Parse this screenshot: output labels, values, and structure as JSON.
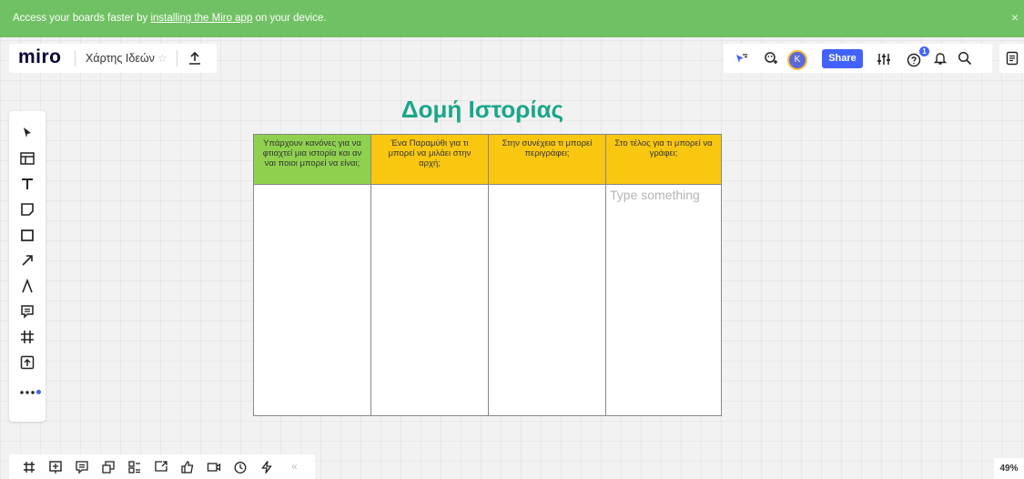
{
  "banner": {
    "prefix": "Access your boards faster by ",
    "link": "installing the Miro app",
    "suffix": " on your device.",
    "close": "×"
  },
  "header": {
    "logo": "miro",
    "board_title": "Χάρτης Ιδεών",
    "star": "☆",
    "share_label": "Share",
    "avatar_initial": "K",
    "help_badge": "1"
  },
  "board": {
    "heading": "Δομή Ιστορίας",
    "columns": [
      {
        "header": "Υπάρχουν κανόνες για να φτιαχτεί μια ιστορία και αν ναι ποιοι μπορεί να είναι;",
        "color": "#8fd14f"
      },
      {
        "header": "Ένα Παραμύθι για τι μπορεί να μιλάει στην αρχή;",
        "color": "#fac710"
      },
      {
        "header": "Στην συνέχεια τι μπορεί περιγράφει;",
        "color": "#fac710"
      },
      {
        "header": "Στο τέλος για τι μπορεί να γράφει;",
        "color": "#fac710",
        "placeholder": "Type something"
      }
    ]
  },
  "left_toolbar": {
    "tools": [
      "select-icon",
      "template-icon",
      "text-icon",
      "sticky-note-icon",
      "shape-icon",
      "arrow-icon",
      "pen-icon",
      "comment-icon",
      "frame-icon",
      "upload-icon",
      "more-icon"
    ]
  },
  "bottom_toolbar": {
    "collapse": "«",
    "zoom": "49%"
  },
  "colors": {
    "banner": "#70c163",
    "accent": "#4262ff",
    "heading": "#1aa68a"
  }
}
